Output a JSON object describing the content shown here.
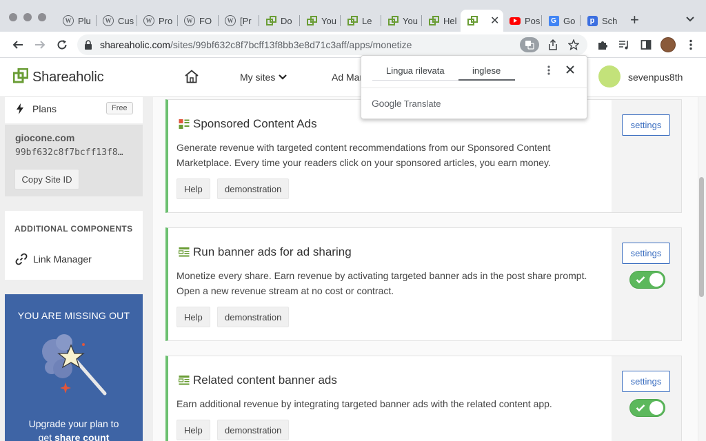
{
  "browser": {
    "tabs": [
      {
        "label": "Plu",
        "icon": "wordpress-icon"
      },
      {
        "label": "Cus",
        "icon": "wordpress-icon"
      },
      {
        "label": "Pro",
        "icon": "wordpress-icon"
      },
      {
        "label": "FO",
        "icon": "wordpress-icon"
      },
      {
        "label": "[Pr",
        "icon": "wordpress-icon"
      },
      {
        "label": "Do",
        "icon": "shareaholic-icon"
      },
      {
        "label": "You",
        "icon": "shareaholic-icon"
      },
      {
        "label": "Le",
        "icon": "shareaholic-icon"
      },
      {
        "label": "You",
        "icon": "shareaholic-icon"
      },
      {
        "label": "Hel",
        "icon": "shareaholic-icon"
      },
      {
        "label": "",
        "icon": "shareaholic-icon"
      },
      {
        "label": "Pos",
        "icon": "youtube-icon"
      },
      {
        "label": "Go",
        "icon": "google-translate-icon"
      },
      {
        "label": "Sch",
        "icon": "p-icon"
      }
    ],
    "url_host": "shareaholic.com",
    "url_path": "/sites/99bf632c8f7bcff13f8bb3e8d71c3aff/apps/monetize"
  },
  "header": {
    "logo_text": "Shareaholic",
    "nav_mysites": "My sites",
    "nav_adman": "Ad Man",
    "username": "sevenpus8th"
  },
  "sidebar": {
    "plans_label": "Plans",
    "plans_badge": "Free",
    "site_domain": "giocone.com",
    "site_id": "99bf632c8f7bcff13f8…",
    "copy_button": "Copy Site ID",
    "additional_title": "ADDITIONAL COMPONENTS",
    "link_manager": "Link Manager",
    "promo_heading": "YOU ARE MISSING OUT",
    "promo_line1": "Upgrade your plan to",
    "promo_line2_pre": "get ",
    "promo_line2_bold": "share count"
  },
  "cards": [
    {
      "title": "Sponsored Content Ads",
      "desc_1": "Generate revenue with targeted content recommendations from our Sponsored Content",
      "desc_2": "Marketplace. Every time your readers click on your sponsored articles, you earn money.",
      "help": "Help",
      "demo": "demonstration",
      "settings": "settings",
      "toggle_on": null
    },
    {
      "title": "Run banner ads for ad sharing",
      "desc_1": "Monetize every share. Earn revenue by activating targeted banner ads in the post share prompt.",
      "desc_2": "Open a new revenue stream at no cost or contract.",
      "help": "Help",
      "demo": "demonstration",
      "settings": "settings",
      "toggle_on": true
    },
    {
      "title": "Related content banner ads",
      "desc_1": "Earn additional revenue by integrating targeted banner ads with the related content app.",
      "desc_2": "",
      "help": "Help",
      "demo": "demonstration",
      "settings": "settings",
      "toggle_on": true
    }
  ],
  "translate_popup": {
    "tab_detected": "Lingua rilevata",
    "tab_target": "inglese",
    "brand_google": "Google",
    "brand_translate": "Translate"
  },
  "colors": {
    "brand_green": "#6a9d35",
    "card_accent": "#6cc070",
    "toggle_on": "#5cb85c",
    "link_blue": "#3b6ec0",
    "promo_bg": "#3e64a5"
  }
}
